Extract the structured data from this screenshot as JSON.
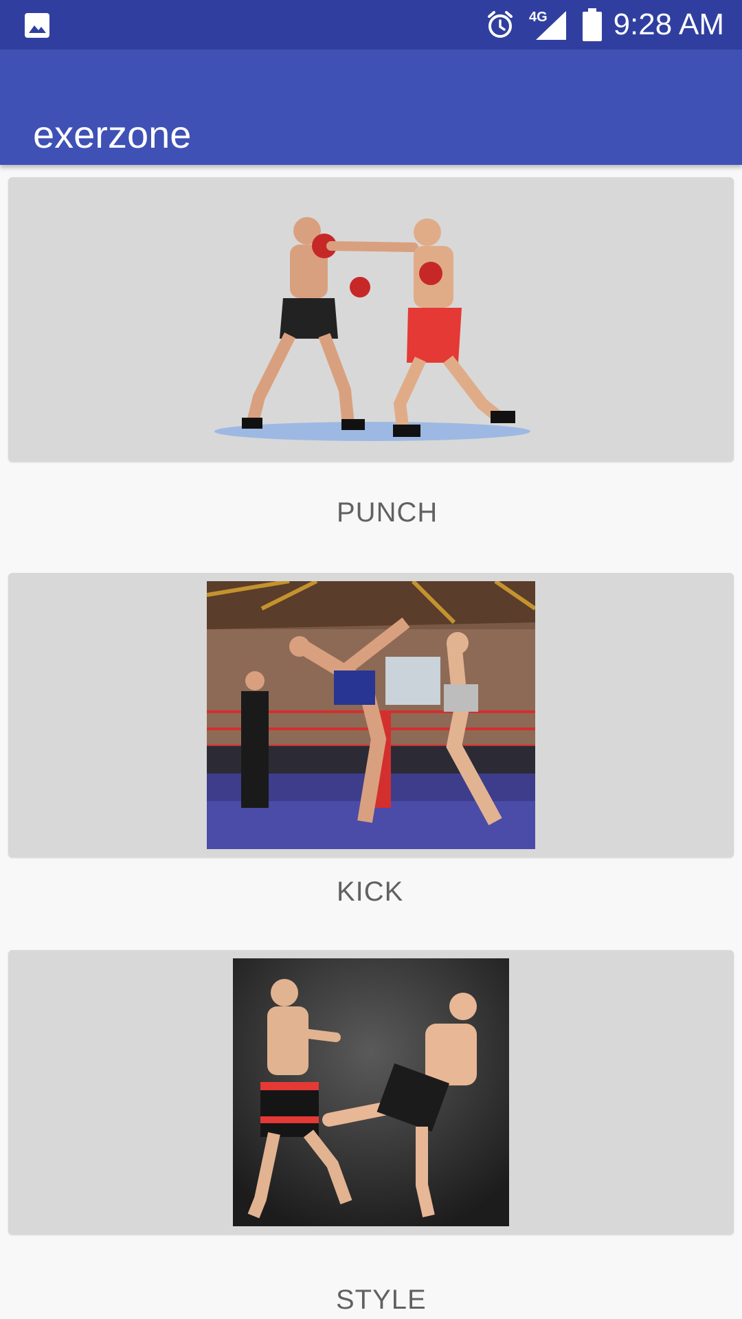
{
  "status_bar": {
    "time": "9:28 AM",
    "network": "4G",
    "icons": [
      "image-notification-icon",
      "alarm-icon",
      "signal-icon",
      "battery-icon"
    ]
  },
  "app_bar": {
    "title": "exerzone",
    "color": "#3f51b5",
    "status_color": "#303f9f"
  },
  "items": [
    {
      "label": "PUNCH",
      "image": "boxers-punching-photo"
    },
    {
      "label": "KICK",
      "image": "kickboxers-ring-photo"
    },
    {
      "label": "STYLE",
      "image": "kickboxers-studio-photo"
    }
  ]
}
